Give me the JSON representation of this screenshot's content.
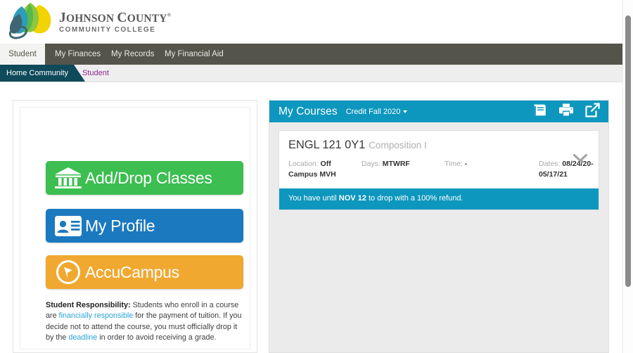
{
  "brand": {
    "name_line1_first": "J",
    "name_line1": "OHNSON ",
    "name_line1_second": "C",
    "name_line1_rest": "OUNTY",
    "name_line2": "COMMUNITY COLLEGE",
    "logo_alt": "jccc-leaf-logo",
    "colors": {
      "leaf_teal": "#2e9dbb",
      "leaf_green": "#8dc63f",
      "leaf_lime": "#57b947",
      "leaf_yellow": "#f2d304",
      "ring_slate": "#3f6672",
      "wordmark": "#58595b"
    }
  },
  "nav": {
    "tabs": [
      {
        "label": "Student",
        "active": true
      },
      {
        "label": "My Finances",
        "active": false
      },
      {
        "label": "My Records",
        "active": false
      },
      {
        "label": "My Financial Aid",
        "active": false
      }
    ]
  },
  "subnav": {
    "home_label": "Home Community",
    "current_label": "Student",
    "home_color": "#0e4a5a",
    "current_color": "#8f2b8f"
  },
  "left_panel": {
    "buttons": [
      {
        "label": "Add/Drop Classes",
        "icon": "bank-building-icon",
        "color": "#3cbe51"
      },
      {
        "label": "My Profile",
        "icon": "id-card-icon",
        "color": "#1b79c0"
      },
      {
        "label": "AccuCampus",
        "icon": "accucampus-circle-icon",
        "color": "#f0a830"
      }
    ],
    "disclaimer": {
      "heading": "Student Responsibility:",
      "text_1": " Students who enroll in a course are ",
      "link_1": "financially responsible",
      "text_2": " for the payment of tuition. If you decide not to attend the course, you must officially drop it by the ",
      "link_2": "deadline",
      "text_3": " in order to avoid receiving a grade.",
      "link_color": "#29a3d4"
    }
  },
  "courses_panel": {
    "title": "My Courses",
    "term": "Credit Fall 2020",
    "header_color": "#0e97be",
    "icons": [
      {
        "name": "book-icon"
      },
      {
        "name": "printer-icon"
      },
      {
        "name": "external-link-icon"
      }
    ],
    "courses": [
      {
        "code": "ENGL 121 0Y1",
        "name": "Composition I",
        "meta": {
          "location_label": "Location:",
          "location_value": "Off Campus MVH",
          "days_label": "Days:",
          "days_value": "MTWRF",
          "time_label": "Time:",
          "time_value": "-",
          "dates_label": "Dates:",
          "dates_value": "08/24/20-05/17/21"
        },
        "expand_icon": "chevron-down-icon",
        "banner": {
          "prefix": "You have until ",
          "emphasis": "NOV 12",
          "suffix": " to drop with a 100% refund."
        }
      }
    ]
  },
  "scrollbar": {
    "name": "vertical-scrollbar",
    "thumb_color": "#8a8a8a"
  }
}
